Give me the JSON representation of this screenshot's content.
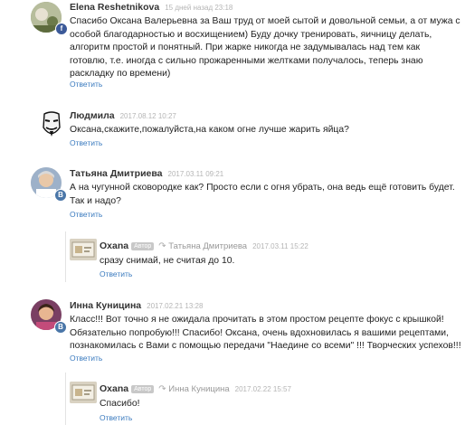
{
  "colors": {
    "link": "#3b7bbf",
    "facebook": "#3b5998",
    "vk": "#4a76a8",
    "date": "#b5b5b5"
  },
  "comments": [
    {
      "author": "Elena Reshetnikova",
      "date": "15 дней назад 23:18",
      "network": "facebook",
      "network_letter": "f",
      "text": "Спасибо Оксана  Валерьевна за  Ваш труд от моей  сытой и довольной  семьи, а от мужа с\nособой благодарностью и восхищением) Буду  дочку  тренировать, яичницу  делать,\nалгоритм  простой  и понятный.  При жарке никогда  не задумывалась над  тем как\nготовлю,  т.е.  иногда  с  сильно прожаренными  желтками получалось, теперь  знаю\nраскладку  по времени)",
      "reply": "Ответить"
    },
    {
      "author": "Людмила",
      "date": "2017.08.12 10:27",
      "text": "Оксана,скажите,пожалуйста,на каком огне лучше жарить яйца?",
      "reply": "Ответить"
    },
    {
      "author": "Татьяна Дмитриева",
      "date": "2017.03.11 09:21",
      "network": "vk",
      "network_letter": "B",
      "text": "А на чугунной сковородке как?  Просто если с огня убрать, она ведь ещё готовить будет.\nТак и надо?",
      "reply": "Ответить"
    },
    {
      "author": "Oxana",
      "tag": "Автор",
      "reply_to": "Татьяна Дмитриева",
      "date": "2017.03.11 15:22",
      "text": "сразу снимай, не считая до 10.",
      "reply": "Ответить"
    },
    {
      "author": "Инна Куницина",
      "date": "2017.02.21 13:28",
      "network": "vk",
      "network_letter": "B",
      "text": "Класс!!! Вот точно я не ожидала прочитать в этом простом рецепте фокус с крышкой!\nОбязательно попробую!!! Спасибо! Оксана, очень вдохновилась я вашими рецептами,\nпознакомилась с Вами с помощью передачи \"Наедине со всеми\" !!! Творческих успехов!!!",
      "reply": "Ответить"
    },
    {
      "author": "Oxana",
      "tag": "Автор",
      "reply_to": "Инна Куницина",
      "date": "2017.02.22 15:57",
      "text": "Спасибо!",
      "reply": "Ответить"
    }
  ]
}
